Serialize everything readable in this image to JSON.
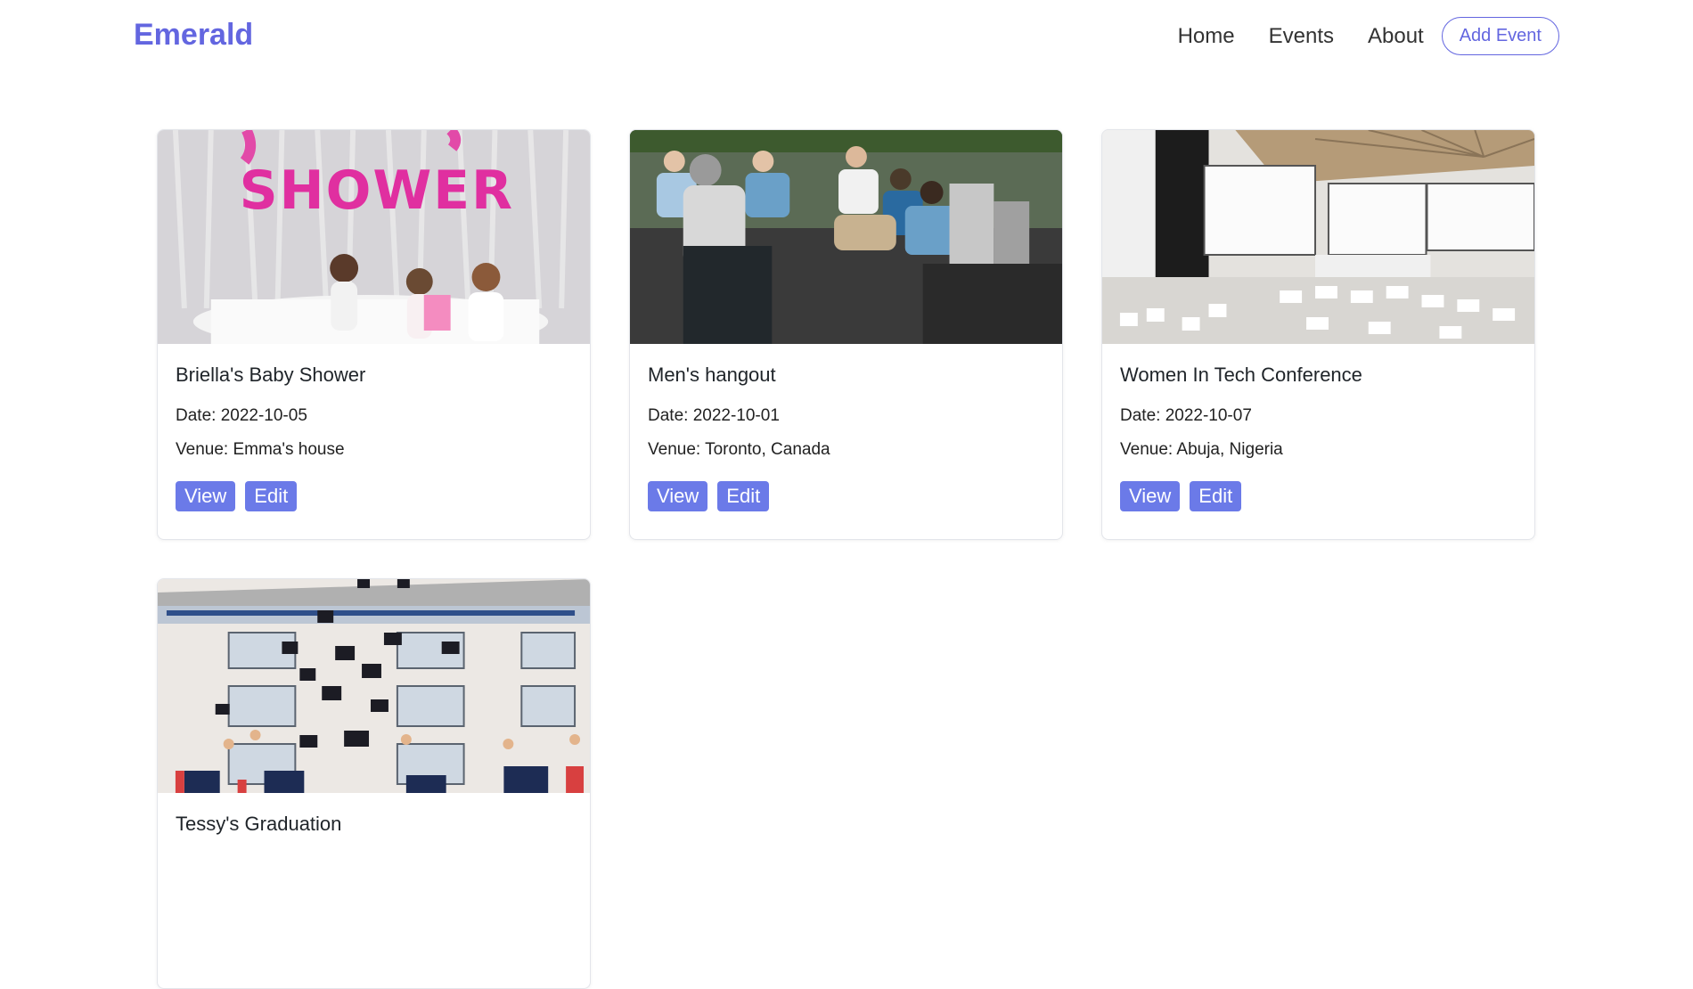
{
  "navbar": {
    "brand": "Emerald",
    "links": [
      "Home",
      "Events",
      "About"
    ],
    "add_event_label": "Add Event"
  },
  "events": [
    {
      "title": "Briella's Baby Shower",
      "date_label": "Date: 2022-10-05",
      "venue_label": "Venue: Emma's house",
      "image": "baby-shower-photo",
      "view_label": "View",
      "edit_label": "Edit"
    },
    {
      "title": "Men's hangout",
      "date_label": "Date: 2022-10-01",
      "venue_label": "Venue: Toronto, Canada",
      "image": "hangout-photo",
      "view_label": "View",
      "edit_label": "Edit"
    },
    {
      "title": "Women In Tech Conference",
      "date_label": "Date: 2022-10-07",
      "venue_label": "Venue: Abuja, Nigeria",
      "image": "conference-hall-photo",
      "view_label": "View",
      "edit_label": "Edit"
    },
    {
      "title": "Tessy's Graduation",
      "image": "graduation-photo"
    }
  ],
  "colors": {
    "brand": "#6366e0",
    "button": "#6b7ae8"
  }
}
